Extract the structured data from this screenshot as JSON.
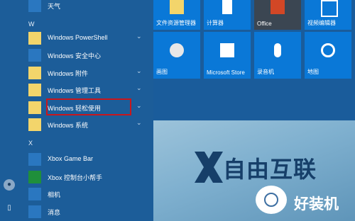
{
  "start_menu": {
    "top_item": {
      "label": "天气"
    },
    "sections": [
      {
        "letter": "W"
      },
      {
        "letter": "X"
      }
    ],
    "w_items": [
      {
        "label": "Windows PowerShell",
        "expandable": true
      },
      {
        "label": "Windows 安全中心",
        "expandable": false
      },
      {
        "label": "Windows 附件",
        "expandable": true
      },
      {
        "label": "Windows 管理工具",
        "expandable": true
      },
      {
        "label": "Windows 轻松使用",
        "expandable": true
      },
      {
        "label": "Windows 系统",
        "expandable": true
      }
    ],
    "x_items": [
      {
        "label": "Xbox Game Bar"
      },
      {
        "label": "Xbox 控制台小帮手"
      },
      {
        "label": "相机"
      },
      {
        "label": "消息"
      }
    ]
  },
  "tiles": {
    "row1": [
      {
        "label": "文件资源管理器"
      },
      {
        "label": "计算器"
      },
      {
        "label": "Office"
      },
      {
        "label": "视频编辑器"
      }
    ],
    "row2": [
      {
        "label": "画图"
      },
      {
        "label": "Microsoft Store"
      },
      {
        "label": "录音机"
      },
      {
        "label": "地图"
      }
    ]
  },
  "watermark": {
    "brand": "自由互联",
    "brand2": "好装机"
  },
  "colors": {
    "start_bg": "#1c5d99",
    "tile_blue": "#0a78d7",
    "highlight_red": "#c8171c"
  },
  "icons": {
    "chevron": "chevron-down-icon",
    "folder": "folder-icon",
    "shield": "shield-icon"
  }
}
